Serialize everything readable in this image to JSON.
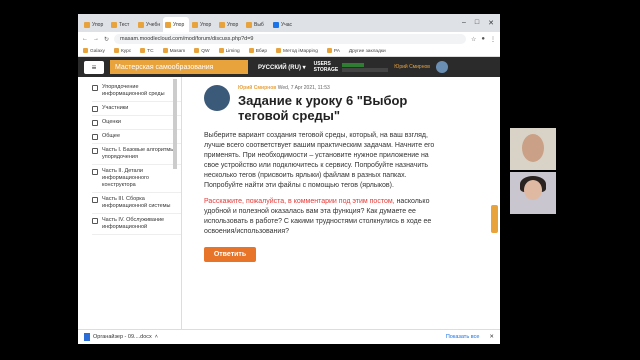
{
  "tabs": [
    {
      "label": "Упор",
      "color": "#e8a33d"
    },
    {
      "label": "Тест",
      "color": "#e8a33d"
    },
    {
      "label": "Учебн",
      "color": "#e8a33d"
    },
    {
      "label": "Упор",
      "color": "#e8a33d",
      "active": true
    },
    {
      "label": "Упор",
      "color": "#e8a33d"
    },
    {
      "label": "Упор",
      "color": "#e8a33d"
    },
    {
      "label": "Выб",
      "color": "#e8a33d"
    },
    {
      "label": "Учас",
      "color": "#1a73e8"
    }
  ],
  "address": {
    "url": "masam.moodlecloud.com/mod/forum/discuss.php?d=9"
  },
  "bookmarks": [
    "Galaxy",
    "Курс",
    "TC",
    "Masam",
    "QW",
    "Liming",
    "Вбир",
    "Метод iMapping",
    "PA",
    "Другие закладки"
  ],
  "moodle": {
    "brand": "Мастерская самообразования",
    "language": "РУССКИЙ (RU)",
    "users_line1": "USERS",
    "users_line2": "STORAGE",
    "user_name": "Юрий Смирнов"
  },
  "sidebar": {
    "items": [
      "Упорядочение информационной среды",
      "Участники",
      "Оценки",
      "Общее",
      "Часть I. Базовые алгоритмы упорядочения",
      "Часть II. Детали информационного конструктора",
      "Часть III. Сборка информационной системы",
      "Часть IV. Обслуживание информационной"
    ]
  },
  "post": {
    "author": "Юрий Смирнов",
    "date": "Wed, 7 Apr 2021, 11:53",
    "title": "Задание к уроку 6 \"Выбор теговой среды\"",
    "body": "Выберите вариант создания теговой среды, который, на ваш взгляд, лучше всего соответствует вашим практическим задачам. Начните его применять. При необходимости – установите нужное приложение на свое устройство или подключитесь к сервису. Попробуйте назначить несколько тегов (присвоить ярлыки) файлам в разных папках. Попробуйте найти эти файлы с помощью тегов (ярлыков).",
    "highlight": "Расскажите, пожалуйста, в комментарии под этим постом,",
    "question": "насколько удобной и полезной оказалась вам эта функция? Как думаете ее использовать в работе? С какими трудностями столкнулись в ходе ее освоения/использования?",
    "reply_label": "Ответить"
  },
  "downloads": {
    "file": "Органайзер - 09....docx",
    "show_all": "Показать все"
  },
  "colors": {
    "accent": "#e8a33d",
    "reply": "#e8742a",
    "highlight": "#e53935"
  }
}
